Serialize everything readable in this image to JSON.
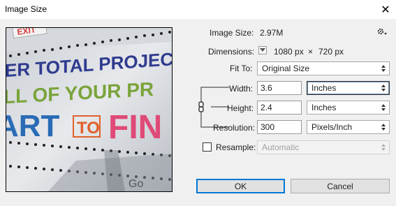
{
  "window": {
    "title": "Image Size",
    "close_glyph": "✕"
  },
  "preview": {
    "sign_lines": [
      "ER TOTAL PROJECT MA",
      "LL OF YOUR PR",
      "ART",
      "TO",
      "FIN"
    ],
    "top_tag": "EXIT",
    "bottom_tag": "Go"
  },
  "image_size": {
    "label": "Image Size:",
    "value": "2.97M"
  },
  "dimensions": {
    "label": "Dimensions:",
    "width": "1080 px",
    "times": "×",
    "height": "720 px"
  },
  "fit_to": {
    "label": "Fit To:",
    "value": "Original Size"
  },
  "width": {
    "label": "Width:",
    "value": "3.6",
    "unit": "Inches"
  },
  "height": {
    "label": "Height:",
    "value": "2.4",
    "unit": "Inches"
  },
  "resolution": {
    "label": "Resolution:",
    "value": "300",
    "unit": "Pixels/Inch"
  },
  "resample": {
    "label": "Resample:",
    "checked": false,
    "value": "Automatic"
  },
  "buttons": {
    "ok": "OK",
    "cancel": "Cancel"
  },
  "colors": {
    "sign_blue": "#2f3b8f",
    "sign_green": "#7aa43b",
    "sign_orange": "#e0602a",
    "sign_pink": "#e04a78",
    "focus_blue": "#0078d7"
  }
}
